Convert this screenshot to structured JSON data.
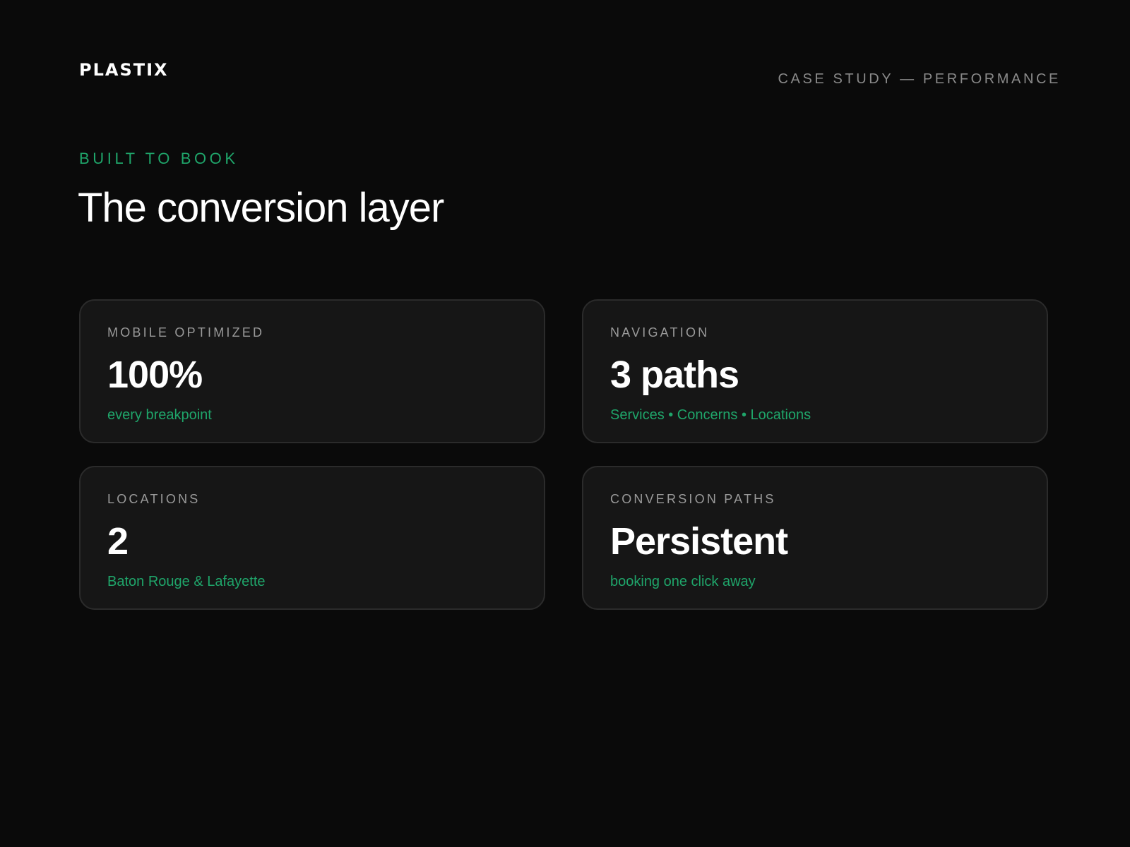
{
  "brand": {
    "logo": "PLASTIX",
    "accent_color": "#1fa56a",
    "background_color": "#0a0a0a"
  },
  "header": {
    "case_study": "CASE STUDY — PERFORMANCE"
  },
  "hero": {
    "eyebrow": "BUILT TO BOOK",
    "title": "The conversion layer"
  },
  "cards": [
    {
      "label": "MOBILE OPTIMIZED",
      "value": "100%",
      "sub": "every breakpoint"
    },
    {
      "label": "NAVIGATION",
      "value": "3 paths",
      "sub": "Services • Concerns • Locations"
    },
    {
      "label": "LOCATIONS",
      "value": "2",
      "sub": "Baton Rouge & Lafayette"
    },
    {
      "label": "CONVERSION PATHS",
      "value": "Persistent",
      "sub": "booking one click away"
    }
  ]
}
